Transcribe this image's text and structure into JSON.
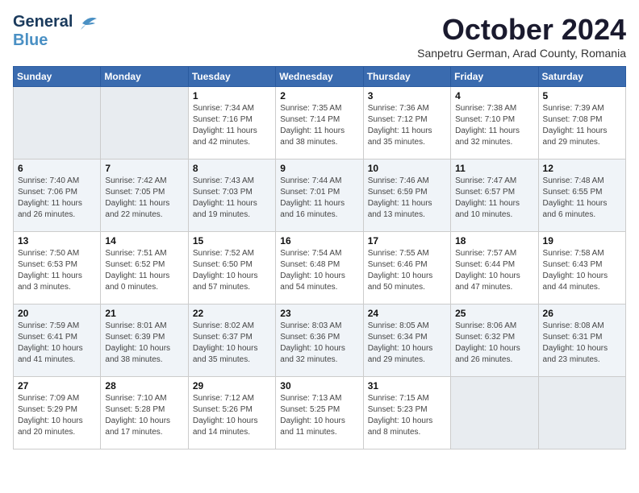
{
  "logo": {
    "line1": "General",
    "line2": "Blue"
  },
  "title": "October 2024",
  "location": "Sanpetru German, Arad County, Romania",
  "days_header": [
    "Sunday",
    "Monday",
    "Tuesday",
    "Wednesday",
    "Thursday",
    "Friday",
    "Saturday"
  ],
  "weeks": [
    [
      {
        "day": "",
        "sunrise": "",
        "sunset": "",
        "daylight": ""
      },
      {
        "day": "",
        "sunrise": "",
        "sunset": "",
        "daylight": ""
      },
      {
        "day": "1",
        "sunrise": "Sunrise: 7:34 AM",
        "sunset": "Sunset: 7:16 PM",
        "daylight": "Daylight: 11 hours and 42 minutes."
      },
      {
        "day": "2",
        "sunrise": "Sunrise: 7:35 AM",
        "sunset": "Sunset: 7:14 PM",
        "daylight": "Daylight: 11 hours and 38 minutes."
      },
      {
        "day": "3",
        "sunrise": "Sunrise: 7:36 AM",
        "sunset": "Sunset: 7:12 PM",
        "daylight": "Daylight: 11 hours and 35 minutes."
      },
      {
        "day": "4",
        "sunrise": "Sunrise: 7:38 AM",
        "sunset": "Sunset: 7:10 PM",
        "daylight": "Daylight: 11 hours and 32 minutes."
      },
      {
        "day": "5",
        "sunrise": "Sunrise: 7:39 AM",
        "sunset": "Sunset: 7:08 PM",
        "daylight": "Daylight: 11 hours and 29 minutes."
      }
    ],
    [
      {
        "day": "6",
        "sunrise": "Sunrise: 7:40 AM",
        "sunset": "Sunset: 7:06 PM",
        "daylight": "Daylight: 11 hours and 26 minutes."
      },
      {
        "day": "7",
        "sunrise": "Sunrise: 7:42 AM",
        "sunset": "Sunset: 7:05 PM",
        "daylight": "Daylight: 11 hours and 22 minutes."
      },
      {
        "day": "8",
        "sunrise": "Sunrise: 7:43 AM",
        "sunset": "Sunset: 7:03 PM",
        "daylight": "Daylight: 11 hours and 19 minutes."
      },
      {
        "day": "9",
        "sunrise": "Sunrise: 7:44 AM",
        "sunset": "Sunset: 7:01 PM",
        "daylight": "Daylight: 11 hours and 16 minutes."
      },
      {
        "day": "10",
        "sunrise": "Sunrise: 7:46 AM",
        "sunset": "Sunset: 6:59 PM",
        "daylight": "Daylight: 11 hours and 13 minutes."
      },
      {
        "day": "11",
        "sunrise": "Sunrise: 7:47 AM",
        "sunset": "Sunset: 6:57 PM",
        "daylight": "Daylight: 11 hours and 10 minutes."
      },
      {
        "day": "12",
        "sunrise": "Sunrise: 7:48 AM",
        "sunset": "Sunset: 6:55 PM",
        "daylight": "Daylight: 11 hours and 6 minutes."
      }
    ],
    [
      {
        "day": "13",
        "sunrise": "Sunrise: 7:50 AM",
        "sunset": "Sunset: 6:53 PM",
        "daylight": "Daylight: 11 hours and 3 minutes."
      },
      {
        "day": "14",
        "sunrise": "Sunrise: 7:51 AM",
        "sunset": "Sunset: 6:52 PM",
        "daylight": "Daylight: 11 hours and 0 minutes."
      },
      {
        "day": "15",
        "sunrise": "Sunrise: 7:52 AM",
        "sunset": "Sunset: 6:50 PM",
        "daylight": "Daylight: 10 hours and 57 minutes."
      },
      {
        "day": "16",
        "sunrise": "Sunrise: 7:54 AM",
        "sunset": "Sunset: 6:48 PM",
        "daylight": "Daylight: 10 hours and 54 minutes."
      },
      {
        "day": "17",
        "sunrise": "Sunrise: 7:55 AM",
        "sunset": "Sunset: 6:46 PM",
        "daylight": "Daylight: 10 hours and 50 minutes."
      },
      {
        "day": "18",
        "sunrise": "Sunrise: 7:57 AM",
        "sunset": "Sunset: 6:44 PM",
        "daylight": "Daylight: 10 hours and 47 minutes."
      },
      {
        "day": "19",
        "sunrise": "Sunrise: 7:58 AM",
        "sunset": "Sunset: 6:43 PM",
        "daylight": "Daylight: 10 hours and 44 minutes."
      }
    ],
    [
      {
        "day": "20",
        "sunrise": "Sunrise: 7:59 AM",
        "sunset": "Sunset: 6:41 PM",
        "daylight": "Daylight: 10 hours and 41 minutes."
      },
      {
        "day": "21",
        "sunrise": "Sunrise: 8:01 AM",
        "sunset": "Sunset: 6:39 PM",
        "daylight": "Daylight: 10 hours and 38 minutes."
      },
      {
        "day": "22",
        "sunrise": "Sunrise: 8:02 AM",
        "sunset": "Sunset: 6:37 PM",
        "daylight": "Daylight: 10 hours and 35 minutes."
      },
      {
        "day": "23",
        "sunrise": "Sunrise: 8:03 AM",
        "sunset": "Sunset: 6:36 PM",
        "daylight": "Daylight: 10 hours and 32 minutes."
      },
      {
        "day": "24",
        "sunrise": "Sunrise: 8:05 AM",
        "sunset": "Sunset: 6:34 PM",
        "daylight": "Daylight: 10 hours and 29 minutes."
      },
      {
        "day": "25",
        "sunrise": "Sunrise: 8:06 AM",
        "sunset": "Sunset: 6:32 PM",
        "daylight": "Daylight: 10 hours and 26 minutes."
      },
      {
        "day": "26",
        "sunrise": "Sunrise: 8:08 AM",
        "sunset": "Sunset: 6:31 PM",
        "daylight": "Daylight: 10 hours and 23 minutes."
      }
    ],
    [
      {
        "day": "27",
        "sunrise": "Sunrise: 7:09 AM",
        "sunset": "Sunset: 5:29 PM",
        "daylight": "Daylight: 10 hours and 20 minutes."
      },
      {
        "day": "28",
        "sunrise": "Sunrise: 7:10 AM",
        "sunset": "Sunset: 5:28 PM",
        "daylight": "Daylight: 10 hours and 17 minutes."
      },
      {
        "day": "29",
        "sunrise": "Sunrise: 7:12 AM",
        "sunset": "Sunset: 5:26 PM",
        "daylight": "Daylight: 10 hours and 14 minutes."
      },
      {
        "day": "30",
        "sunrise": "Sunrise: 7:13 AM",
        "sunset": "Sunset: 5:25 PM",
        "daylight": "Daylight: 10 hours and 11 minutes."
      },
      {
        "day": "31",
        "sunrise": "Sunrise: 7:15 AM",
        "sunset": "Sunset: 5:23 PM",
        "daylight": "Daylight: 10 hours and 8 minutes."
      },
      {
        "day": "",
        "sunrise": "",
        "sunset": "",
        "daylight": ""
      },
      {
        "day": "",
        "sunrise": "",
        "sunset": "",
        "daylight": ""
      }
    ]
  ]
}
